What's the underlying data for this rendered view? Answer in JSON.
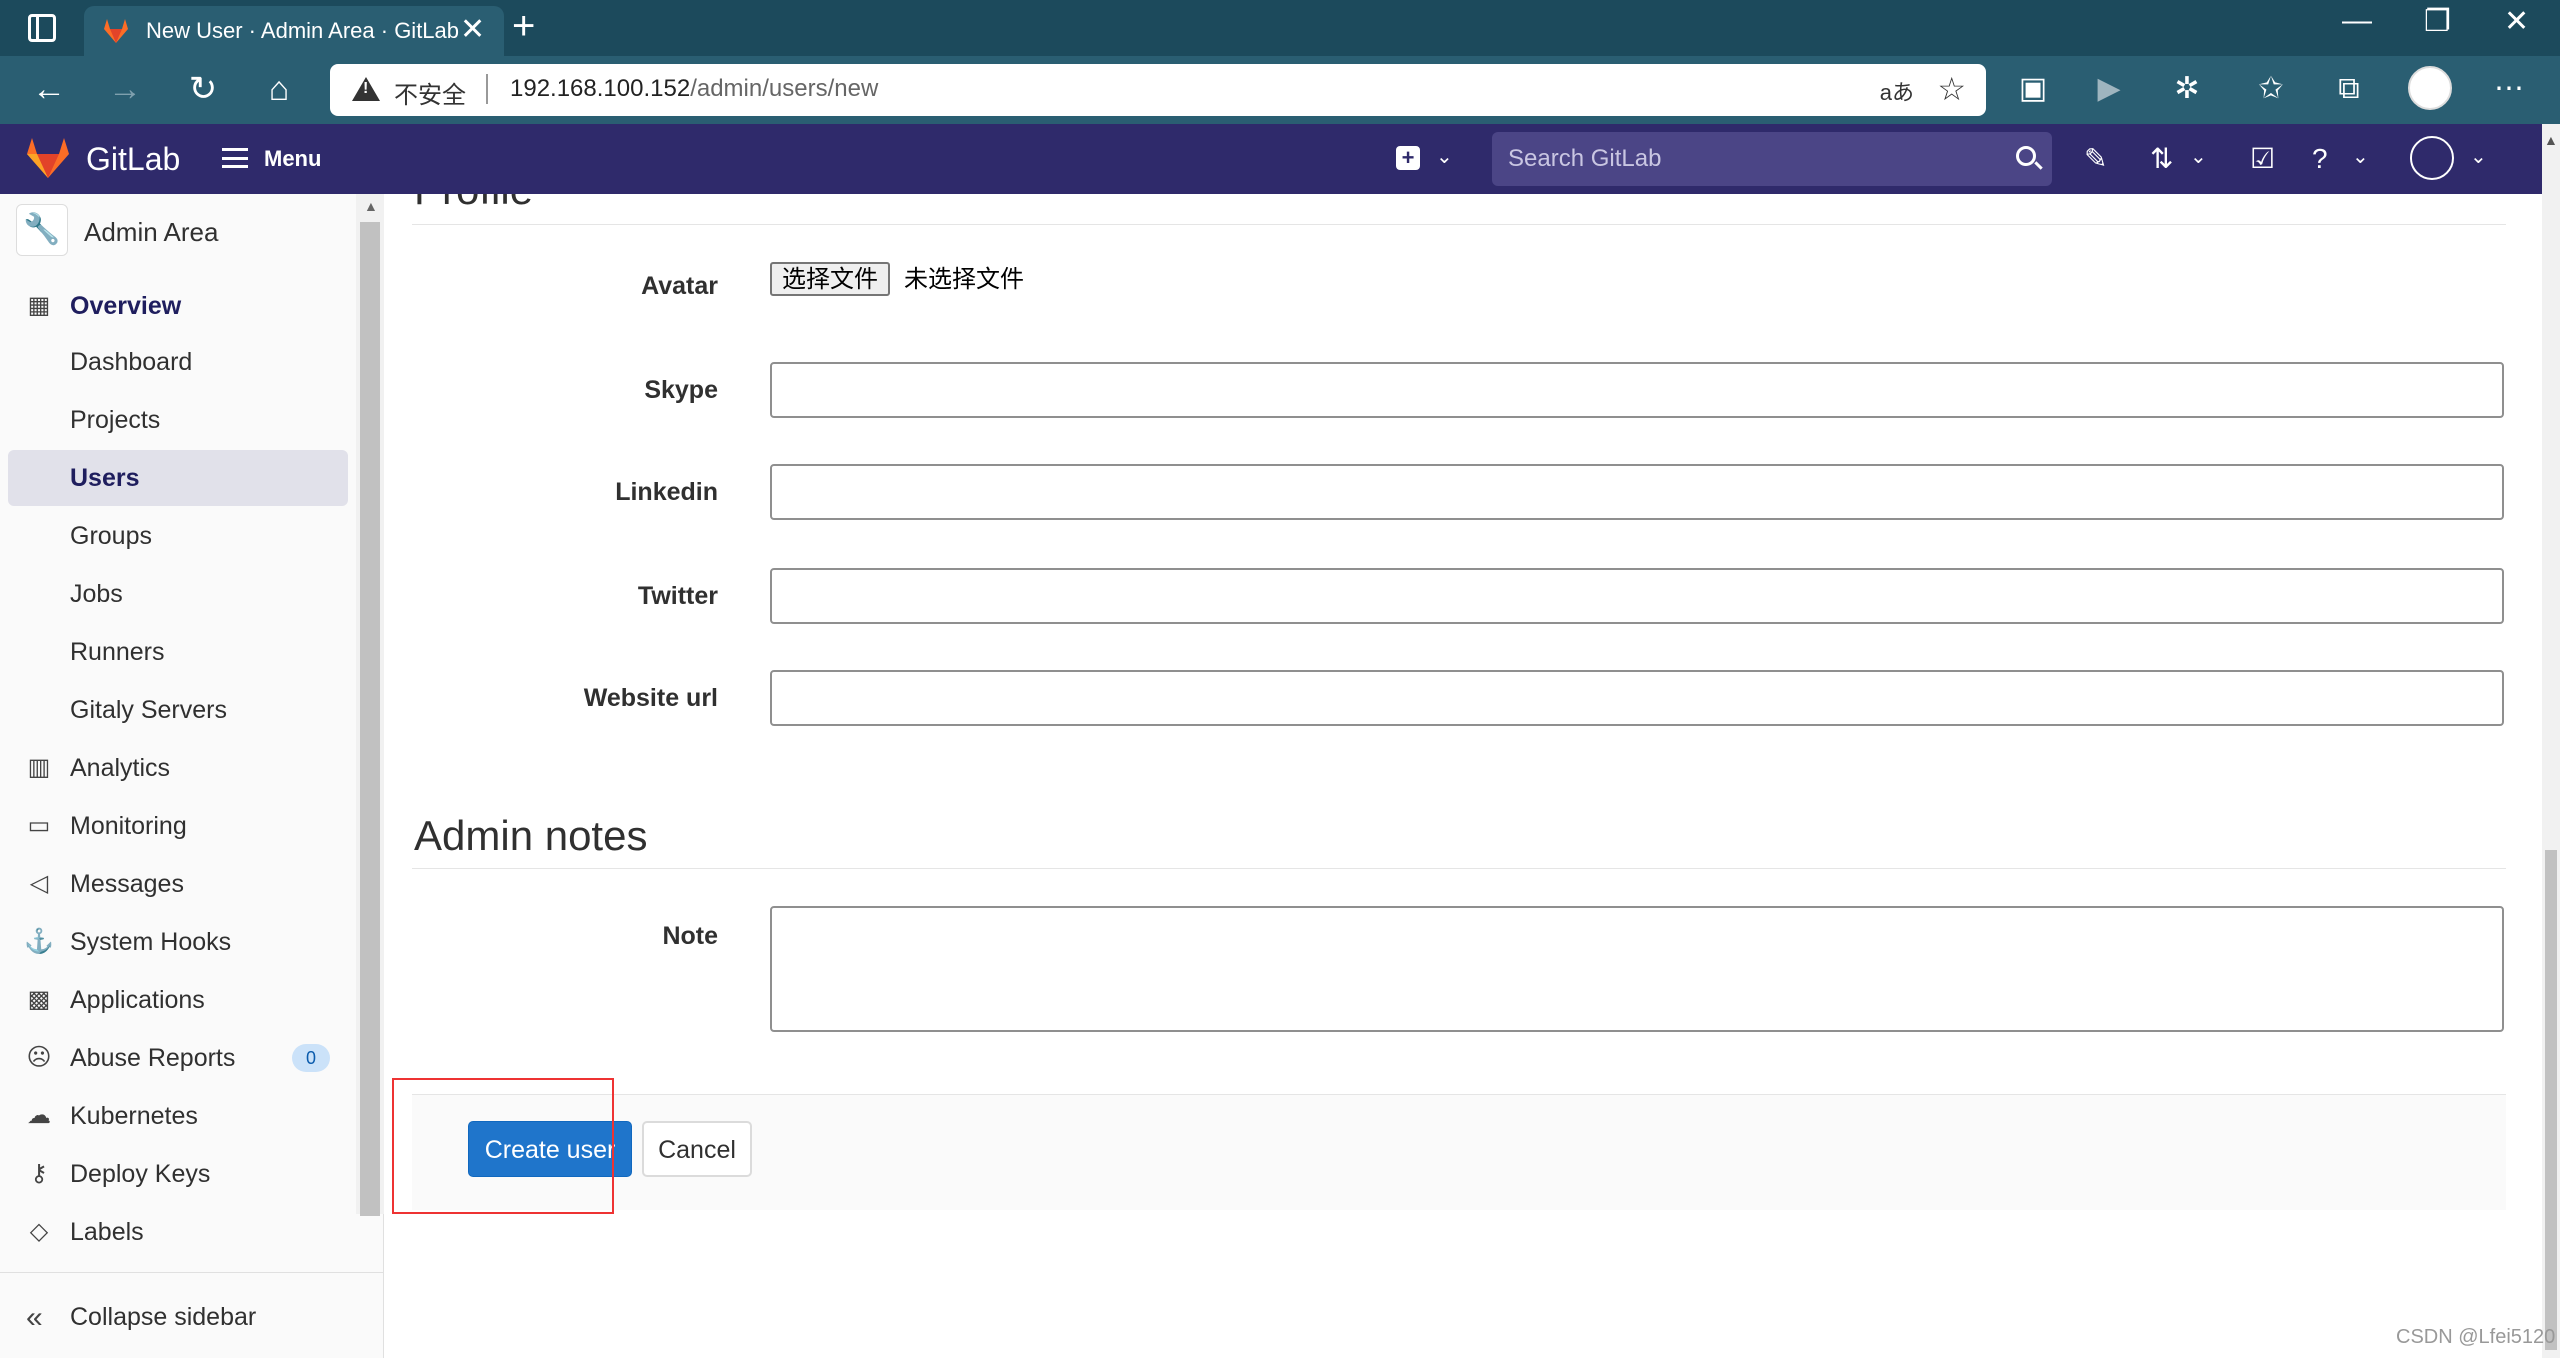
{
  "browser": {
    "tab_title": "New User · Admin Area · GitLab",
    "tab_close": "✕",
    "new_tab": "+",
    "window_controls": [
      "—",
      "❐",
      "✕"
    ],
    "address": {
      "security_label": "不安全",
      "host": "192.168.100.152",
      "path": "/admin/users/new",
      "read_aloud": "aあ"
    }
  },
  "gitlab": {
    "brand": "GitLab",
    "menu_label": "Menu",
    "search_placeholder": "Search GitLab"
  },
  "sidebar": {
    "header": "Admin Area",
    "items": [
      {
        "label": "Overview",
        "icon": "overview-icon",
        "section": true
      },
      {
        "label": "Dashboard"
      },
      {
        "label": "Projects"
      },
      {
        "label": "Users",
        "active": true
      },
      {
        "label": "Groups"
      },
      {
        "label": "Jobs"
      },
      {
        "label": "Runners"
      },
      {
        "label": "Gitaly Servers"
      },
      {
        "label": "Analytics",
        "icon": "analytics-icon"
      },
      {
        "label": "Monitoring",
        "icon": "monitoring-icon"
      },
      {
        "label": "Messages",
        "icon": "messages-icon"
      },
      {
        "label": "System Hooks",
        "icon": "hook-icon"
      },
      {
        "label": "Applications",
        "icon": "applications-icon"
      },
      {
        "label": "Abuse Reports",
        "icon": "abuse-icon",
        "badge": "0"
      },
      {
        "label": "Kubernetes",
        "icon": "kubernetes-icon"
      },
      {
        "label": "Deploy Keys",
        "icon": "key-icon"
      },
      {
        "label": "Labels",
        "icon": "label-icon"
      }
    ],
    "collapse_label": "Collapse sidebar"
  },
  "form": {
    "profile_title": "Profile",
    "avatar_label": "Avatar",
    "file_button": "选择文件",
    "file_status": "未选择文件",
    "skype_label": "Skype",
    "skype_value": "",
    "linkedin_label": "Linkedin",
    "linkedin_value": "",
    "twitter_label": "Twitter",
    "twitter_value": "",
    "website_label": "Website url",
    "website_value": "",
    "admin_notes_title": "Admin notes",
    "note_label": "Note",
    "note_value": "",
    "create_button": "Create user",
    "cancel_button": "Cancel"
  },
  "watermark": "CSDN @Lfei5120",
  "colors": {
    "navbar": "#2f2a6b",
    "primary_button": "#1f75cb",
    "browser_frame": "#1c4a5c",
    "highlight": "#ee3333"
  }
}
